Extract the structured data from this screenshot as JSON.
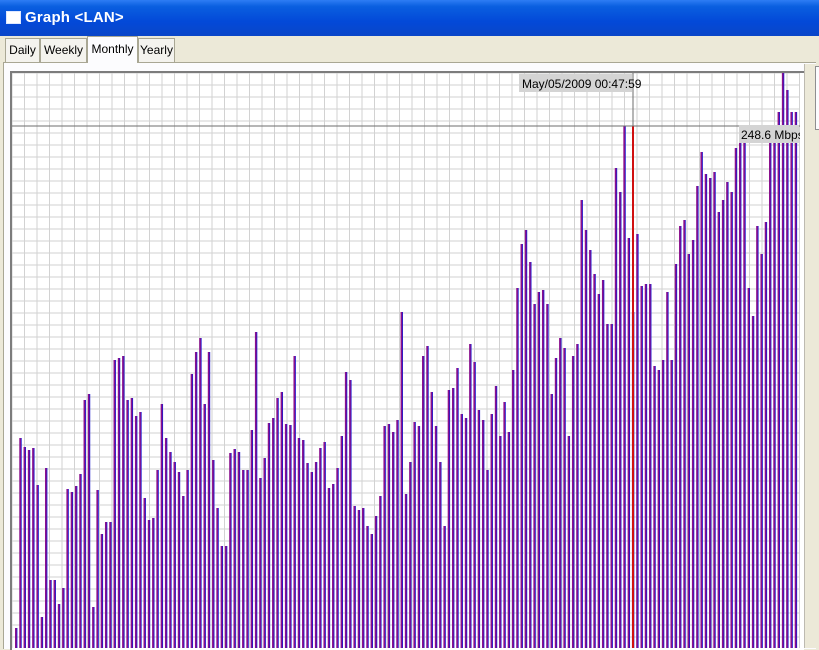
{
  "window": {
    "title": "Graph <LAN>"
  },
  "tabs": [
    {
      "label": "Daily"
    },
    {
      "label": "Weekly"
    },
    {
      "label": "Monthly",
      "active": true
    },
    {
      "label": "Yearly"
    }
  ],
  "graph": {
    "cursor_timestamp": "May/05/2009 00:47:59",
    "cursor_value": "248.6 Mbps",
    "bar_colors": {
      "primary": "#8b0f8c",
      "secondary": "#1a1ad0",
      "cursor": "#d01010"
    },
    "grid_color": "#d2d2d2",
    "chart_data": {
      "type": "bar",
      "series": [
        {
          "values": [
            20,
            210,
            201,
            198,
            200,
            163,
            31,
            180,
            68,
            68,
            44,
            60,
            159,
            156,
            162,
            174,
            248,
            254,
            41,
            158,
            114,
            126,
            126,
            288,
            290,
            292,
            248,
            250,
            232,
            236,
            150,
            128,
            130,
            178,
            244,
            210,
            196,
            186,
            176,
            152,
            178,
            274,
            296,
            310,
            244,
            296,
            188,
            140,
            102,
            102,
            195,
            199,
            196,
            178,
            178,
            218,
            316,
            170,
            190,
            225,
            230,
            250,
            256,
            224,
            223,
            292,
            210,
            208,
            185,
            176,
            186,
            200,
            206,
            160,
            164,
            180,
            212,
            276,
            268,
            142,
            138,
            140,
            122,
            114,
            132,
            152,
            222,
            224,
            216,
            228,
            336,
            154,
            186,
            226,
            222,
            292,
            302,
            256,
            222,
            186,
            122,
            258,
            260,
            280,
            234,
            230,
            304,
            286,
            238,
            228,
            178,
            234,
            262,
            212,
            246,
            216,
            278,
            360,
            404,
            418,
            386,
            344,
            356,
            358,
            344,
            254,
            290,
            310,
            300,
            212,
            292,
            304,
            448,
            418,
            398,
            374,
            354,
            368,
            324,
            324,
            480,
            456,
            522,
            410,
            336,
            414,
            362,
            364,
            364,
            282,
            278,
            288,
            356,
            288,
            384,
            422,
            428,
            394,
            408,
            462,
            496,
            474,
            470,
            476,
            436,
            448,
            466,
            456,
            500,
            518,
            506,
            360,
            332,
            422,
            394,
            426,
            516,
            518,
            536,
            584,
            558,
            536,
            536
          ]
        }
      ]
    }
  }
}
